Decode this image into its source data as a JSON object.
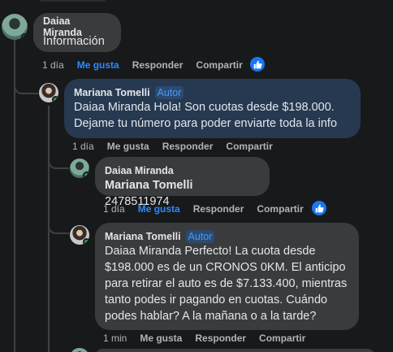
{
  "comments": [
    {
      "author": "Daiaa Miranda",
      "text": "Información",
      "time": "1 día",
      "like_label": "Me gusta",
      "reply_label": "Responder",
      "share_label": "Compartir",
      "liked": true
    },
    {
      "author": "Mariana Tomelli",
      "badge": "Autor",
      "text": "Daiaa Miranda Hola! Son cuotas desde $198.000.\nDejame tu número para poder enviarte toda la info",
      "time": "1 día",
      "like_label": "Me gusta",
      "reply_label": "Responder",
      "share_label": "Compartir",
      "liked": false
    },
    {
      "author": "Daiaa Miranda",
      "mention": "Mariana Tomelli",
      "text": " 2478511974",
      "time": "1 día",
      "like_label": "Me gusta",
      "reply_label": "Responder",
      "share_label": "Compartir",
      "liked": true
    },
    {
      "author": "Mariana Tomelli",
      "badge": "Autor",
      "text": "Daiaa Miranda Perfecto! La cuota desde\n$198.000 es de un CRONOS 0KM. El anticipo\npara retirar el auto es de $7.133.400, mientras\ntanto podes ir pagando en cuotas. Cuándo\npodes hablar? A la mañana o a la tarde?",
      "time": "1 min",
      "like_label": "Me gusta",
      "reply_label": "Responder",
      "share_label": "Compartir",
      "liked": false
    }
  ],
  "colors": {
    "background": "#18191a",
    "bubble": "#3a3b3c",
    "author_bubble": "#263951",
    "accent": "#2e89ff",
    "online": "#31a24c"
  },
  "icons": [
    "like-reaction-icon",
    "online-status-icon"
  ]
}
